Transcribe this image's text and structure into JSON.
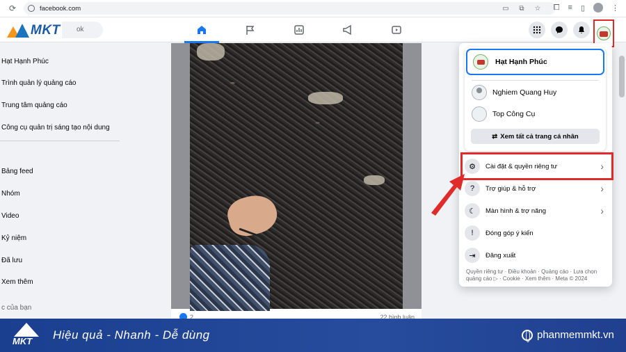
{
  "browser": {
    "url": "facebook.com"
  },
  "fb_nav": {
    "search_placeholder": "ok",
    "logo_text": "MKT"
  },
  "sidebar": {
    "items_top": [
      "Hạt Hạnh Phúc",
      "Trình quản lý quảng cáo",
      "Trung tâm quảng cáo",
      "Công cụ quản trị sáng tạo nội dung"
    ],
    "items_bottom": [
      "Bảng feed",
      "Nhóm",
      "Video",
      "Kỷ niệm",
      "Đã lưu",
      "Xem thêm",
      "c của bạn"
    ]
  },
  "post": {
    "like_count": "2",
    "comment_count": "22 bình luận"
  },
  "dropdown": {
    "current_profile": "Hạt Hạnh Phúc",
    "profiles": [
      "Nghiem Quang Huy",
      "Top Công Cụ"
    ],
    "see_all": "Xem tất cả trang cá nhân",
    "menu": [
      {
        "label": "Cài đặt & quyền riêng tư",
        "icon": "gear-icon"
      },
      {
        "label": "Trợ giúp & hỗ trợ",
        "icon": "help-icon"
      },
      {
        "label": "Màn hình & trợ năng",
        "icon": "moon-icon"
      },
      {
        "label": "Đóng góp ý kiến",
        "icon": "feedback-icon"
      },
      {
        "label": "Đăng xuất",
        "icon": "logout-icon"
      }
    ],
    "footer": "Quyền riêng tư · Điều khoản · Quảng cáo · Lựa chọn quảng cáo ▷ · Cookie · Xem thêm · Meta © 2024"
  },
  "banner": {
    "logo_text": "MKT",
    "slogan": "Hiệu quả - Nhanh  - Dễ dùng",
    "website": "phanmemmkt.vn"
  },
  "colors": {
    "accent": "#1877f2",
    "highlight": "#e02b2b",
    "banner": "#1b3f8f"
  }
}
